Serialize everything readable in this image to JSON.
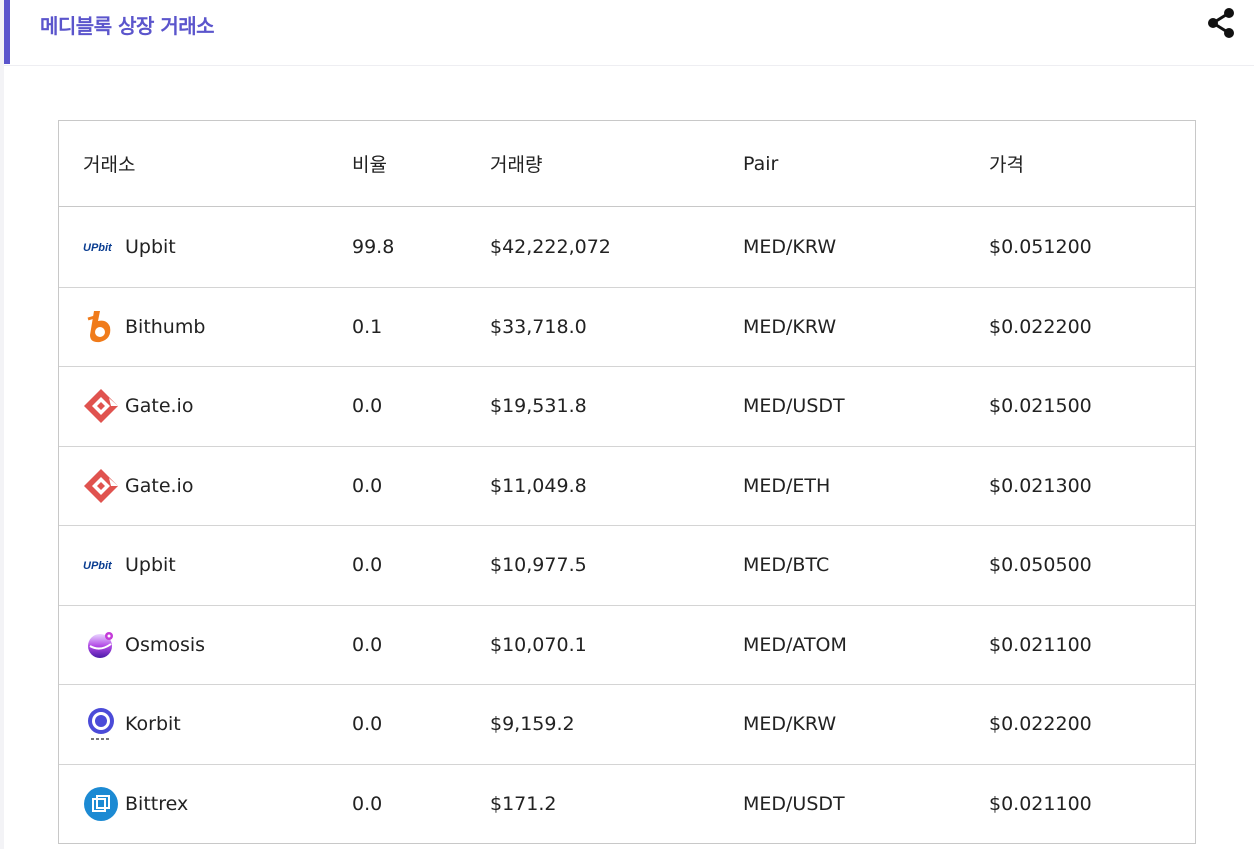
{
  "header": {
    "title": "메디블록 상장 거래소"
  },
  "table": {
    "columns": [
      "거래소",
      "비율",
      "거래량",
      "Pair",
      "가격"
    ],
    "rows": [
      {
        "logo": "upbit-logo",
        "exchange": "Upbit",
        "ratio": "99.8",
        "volume": "$42,222,072",
        "pair": "MED/KRW",
        "price": "$0.051200"
      },
      {
        "logo": "bithumb-logo",
        "exchange": "Bithumb",
        "ratio": "0.1",
        "volume": "$33,718.0",
        "pair": "MED/KRW",
        "price": "$0.022200"
      },
      {
        "logo": "gateio-logo",
        "exchange": "Gate.io",
        "ratio": "0.0",
        "volume": "$19,531.8",
        "pair": "MED/USDT",
        "price": "$0.021500"
      },
      {
        "logo": "gateio-logo",
        "exchange": "Gate.io",
        "ratio": "0.0",
        "volume": "$11,049.8",
        "pair": "MED/ETH",
        "price": "$0.021300"
      },
      {
        "logo": "upbit-logo",
        "exchange": "Upbit",
        "ratio": "0.0",
        "volume": "$10,977.5",
        "pair": "MED/BTC",
        "price": "$0.050500"
      },
      {
        "logo": "osmosis-logo",
        "exchange": "Osmosis",
        "ratio": "0.0",
        "volume": "$10,070.1",
        "pair": "MED/ATOM",
        "price": "$0.021100"
      },
      {
        "logo": "korbit-logo",
        "exchange": "Korbit",
        "ratio": "0.0",
        "volume": "$9,159.2",
        "pair": "MED/KRW",
        "price": "$0.022200"
      },
      {
        "logo": "bittrex-logo",
        "exchange": "Bittrex",
        "ratio": "0.0",
        "volume": "$171.2",
        "pair": "MED/USDT",
        "price": "$0.021100"
      }
    ]
  },
  "icons": {
    "share": "share-icon"
  },
  "colors": {
    "accent": "#5b55cc",
    "upbit": "#0a3d91",
    "bithumb": "#f07b1a",
    "gateio": "#e0534f",
    "osmosis": "#8b2fd6",
    "korbit": "#4b4bd8",
    "bittrex": "#1c8ad3"
  },
  "logo_text": {
    "upbit": "UPbit"
  }
}
